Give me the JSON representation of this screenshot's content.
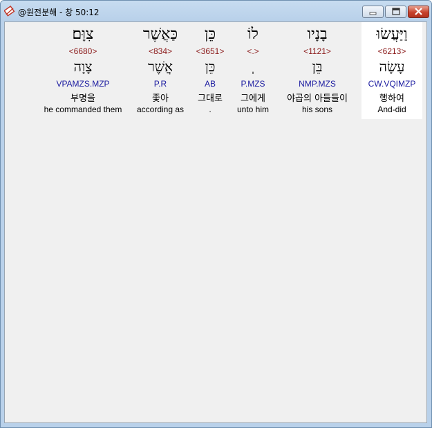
{
  "window": {
    "title": "@원전분해 - 창 50:12"
  },
  "words": [
    {
      "hebrew": "וַיַּעֲשׂוּ",
      "strong": "<6213>",
      "lemma": "עָשָׂה",
      "morph": "CW.VQIMZP",
      "korean": "행하여",
      "english": "And-did",
      "highlighted": true
    },
    {
      "hebrew": "בָנָיו",
      "strong": "<1121>",
      "lemma": "בֵּן",
      "morph": "NMP.MZS",
      "korean": "야곱의 아들들이",
      "english": "his sons",
      "highlighted": false
    },
    {
      "hebrew": "לוֹ",
      "strong": "<.>",
      "lemma": "ְ",
      "morph": "P.MZS",
      "korean": "그에게",
      "english": "unto him",
      "highlighted": false
    },
    {
      "hebrew": "כֵּן",
      "strong": "<3651>",
      "lemma": "כֵּן",
      "morph": "AB",
      "korean": "그대로",
      "english": ".",
      "highlighted": false
    },
    {
      "hebrew": "כַּאֲשֶׁר",
      "strong": "<834>",
      "lemma": "אֲשֶׁר",
      "morph": "P.R",
      "korean": "좇아",
      "english": "according as",
      "highlighted": false
    },
    {
      "hebrew": "צִוָּם׃",
      "strong": "<6680>",
      "lemma": "צָוָה",
      "morph": "VPAMZS.MZP",
      "korean": "부명을",
      "english": "he commanded them",
      "highlighted": false
    }
  ]
}
